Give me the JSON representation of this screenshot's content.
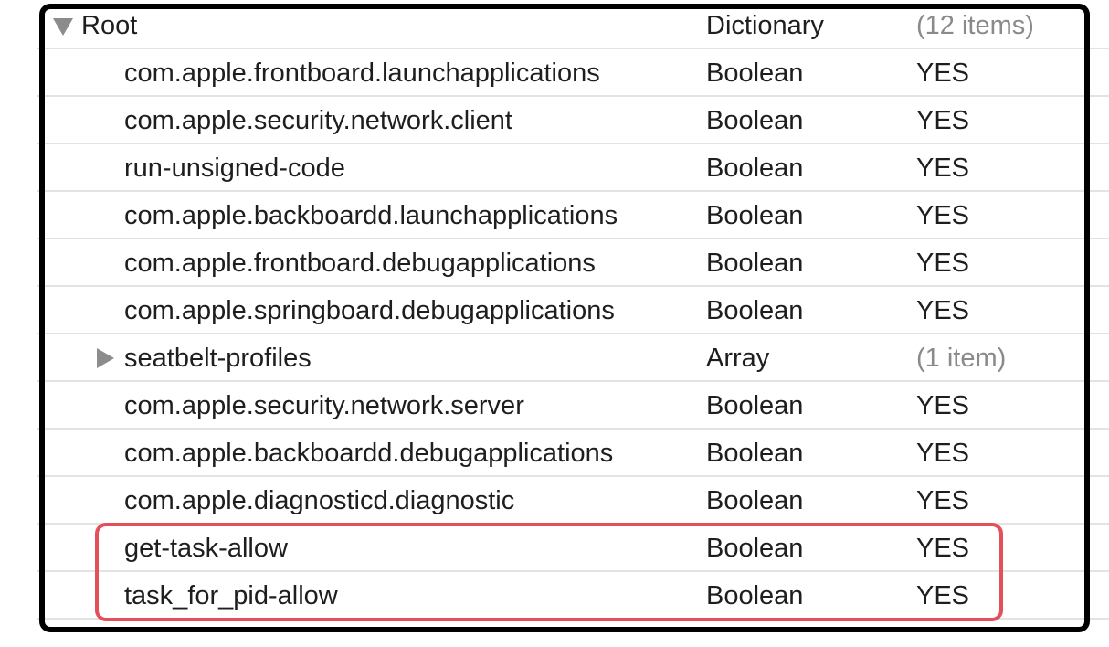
{
  "root": {
    "key": "Root",
    "type": "Dictionary",
    "value": "(12 items)",
    "icon": "disclosure-triangle-expanded"
  },
  "rows": [
    {
      "key": "com.apple.frontboard.launchapplications",
      "type": "Boolean",
      "value": "YES"
    },
    {
      "key": "com.apple.security.network.client",
      "type": "Boolean",
      "value": "YES"
    },
    {
      "key": "run-unsigned-code",
      "type": "Boolean",
      "value": "YES"
    },
    {
      "key": "com.apple.backboardd.launchapplications",
      "type": "Boolean",
      "value": "YES"
    },
    {
      "key": "com.apple.frontboard.debugapplications",
      "type": "Boolean",
      "value": "YES"
    },
    {
      "key": "com.apple.springboard.debugapplications",
      "type": "Boolean",
      "value": "YES"
    },
    {
      "key": "seatbelt-profiles",
      "type": "Array",
      "value": "(1 item)",
      "icon": "disclosure-triangle-collapsed"
    },
    {
      "key": "com.apple.security.network.server",
      "type": "Boolean",
      "value": "YES"
    },
    {
      "key": "com.apple.backboardd.debugapplications",
      "type": "Boolean",
      "value": "YES"
    },
    {
      "key": "com.apple.diagnosticd.diagnostic",
      "type": "Boolean",
      "value": "YES"
    },
    {
      "key": "get-task-allow",
      "type": "Boolean",
      "value": "YES"
    },
    {
      "key": "task_for_pid-allow",
      "type": "Boolean",
      "value": "YES"
    }
  ],
  "colors": {
    "frame": "#000000",
    "highlight": "#e4505a",
    "muted": "#8a8a8a"
  }
}
